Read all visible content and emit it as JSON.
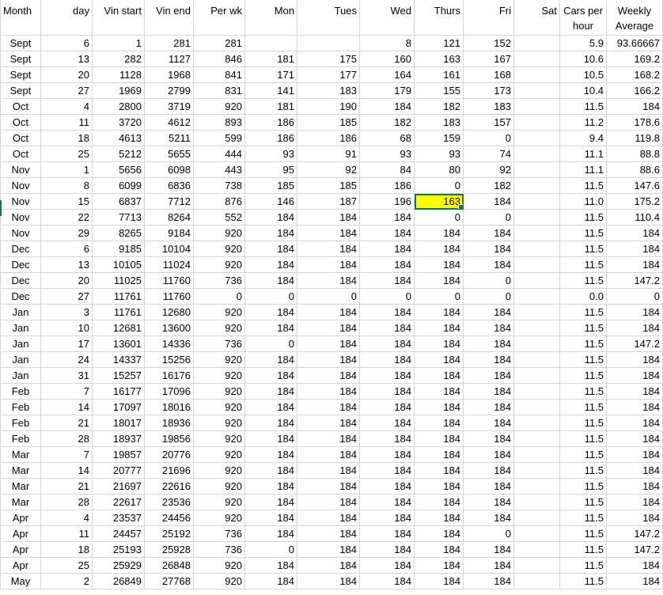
{
  "headers": [
    "Month",
    "day",
    "Vin start",
    "Vin end",
    "Per wk",
    "Mon",
    "Tues",
    "Wed",
    "Thurs",
    "Fri",
    "Sat",
    "Cars per hour",
    "Weekly Average"
  ],
  "header_align": [
    "first",
    "",
    "",
    "",
    "",
    "",
    "",
    "",
    "",
    "",
    "",
    "ctr",
    "ctr"
  ],
  "selected_cell": {
    "row": 10,
    "col": 8,
    "fill": "#ffff00",
    "border": "#217346"
  },
  "grid_color": "#d4d4d4",
  "rows": [
    [
      "Sept",
      "6",
      "1",
      "281",
      "281",
      "",
      "",
      "8",
      "121",
      "152",
      "",
      "5.9",
      "93.66667"
    ],
    [
      "Sept",
      "13",
      "282",
      "1127",
      "846",
      "181",
      "175",
      "160",
      "163",
      "167",
      "",
      "10.6",
      "169.2"
    ],
    [
      "Sept",
      "20",
      "1128",
      "1968",
      "841",
      "171",
      "177",
      "164",
      "161",
      "168",
      "",
      "10.5",
      "168.2"
    ],
    [
      "Sept",
      "27",
      "1969",
      "2799",
      "831",
      "141",
      "183",
      "179",
      "155",
      "173",
      "",
      "10.4",
      "166.2"
    ],
    [
      "Oct",
      "4",
      "2800",
      "3719",
      "920",
      "181",
      "190",
      "184",
      "182",
      "183",
      "",
      "11.5",
      "184"
    ],
    [
      "Oct",
      "11",
      "3720",
      "4612",
      "893",
      "186",
      "185",
      "182",
      "183",
      "157",
      "",
      "11.2",
      "178.6"
    ],
    [
      "Oct",
      "18",
      "4613",
      "5211",
      "599",
      "186",
      "186",
      "68",
      "159",
      "0",
      "",
      "9.4",
      "119.8"
    ],
    [
      "Oct",
      "25",
      "5212",
      "5655",
      "444",
      "93",
      "91",
      "93",
      "93",
      "74",
      "",
      "11.1",
      "88.8"
    ],
    [
      "Nov",
      "1",
      "5656",
      "6098",
      "443",
      "95",
      "92",
      "84",
      "80",
      "92",
      "",
      "11.1",
      "88.6"
    ],
    [
      "Nov",
      "8",
      "6099",
      "6836",
      "738",
      "185",
      "185",
      "186",
      "0",
      "182",
      "",
      "11.5",
      "147.6"
    ],
    [
      "Nov",
      "15",
      "6837",
      "7712",
      "876",
      "146",
      "187",
      "196",
      "163",
      "184",
      "",
      "11.0",
      "175.2"
    ],
    [
      "Nov",
      "22",
      "7713",
      "8264",
      "552",
      "184",
      "184",
      "184",
      "0",
      "0",
      "",
      "11.5",
      "110.4"
    ],
    [
      "Nov",
      "29",
      "8265",
      "9184",
      "920",
      "184",
      "184",
      "184",
      "184",
      "184",
      "",
      "11.5",
      "184"
    ],
    [
      "Dec",
      "6",
      "9185",
      "10104",
      "920",
      "184",
      "184",
      "184",
      "184",
      "184",
      "",
      "11.5",
      "184"
    ],
    [
      "Dec",
      "13",
      "10105",
      "11024",
      "920",
      "184",
      "184",
      "184",
      "184",
      "184",
      "",
      "11.5",
      "184"
    ],
    [
      "Dec",
      "20",
      "11025",
      "11760",
      "736",
      "184",
      "184",
      "184",
      "184",
      "0",
      "",
      "11.5",
      "147.2"
    ],
    [
      "Dec",
      "27",
      "11761",
      "11760",
      "0",
      "0",
      "0",
      "0",
      "0",
      "0",
      "",
      "0.0",
      "0"
    ],
    [
      "Jan",
      "3",
      "11761",
      "12680",
      "920",
      "184",
      "184",
      "184",
      "184",
      "184",
      "",
      "11.5",
      "184"
    ],
    [
      "Jan",
      "10",
      "12681",
      "13600",
      "920",
      "184",
      "184",
      "184",
      "184",
      "184",
      "",
      "11.5",
      "184"
    ],
    [
      "Jan",
      "17",
      "13601",
      "14336",
      "736",
      "0",
      "184",
      "184",
      "184",
      "184",
      "",
      "11.5",
      "147.2"
    ],
    [
      "Jan",
      "24",
      "14337",
      "15256",
      "920",
      "184",
      "184",
      "184",
      "184",
      "184",
      "",
      "11.5",
      "184"
    ],
    [
      "Jan",
      "31",
      "15257",
      "16176",
      "920",
      "184",
      "184",
      "184",
      "184",
      "184",
      "",
      "11.5",
      "184"
    ],
    [
      "Feb",
      "7",
      "16177",
      "17096",
      "920",
      "184",
      "184",
      "184",
      "184",
      "184",
      "",
      "11.5",
      "184"
    ],
    [
      "Feb",
      "14",
      "17097",
      "18016",
      "920",
      "184",
      "184",
      "184",
      "184",
      "184",
      "",
      "11.5",
      "184"
    ],
    [
      "Feb",
      "21",
      "18017",
      "18936",
      "920",
      "184",
      "184",
      "184",
      "184",
      "184",
      "",
      "11.5",
      "184"
    ],
    [
      "Feb",
      "28",
      "18937",
      "19856",
      "920",
      "184",
      "184",
      "184",
      "184",
      "184",
      "",
      "11.5",
      "184"
    ],
    [
      "Mar",
      "7",
      "19857",
      "20776",
      "920",
      "184",
      "184",
      "184",
      "184",
      "184",
      "",
      "11.5",
      "184"
    ],
    [
      "Mar",
      "14",
      "20777",
      "21696",
      "920",
      "184",
      "184",
      "184",
      "184",
      "184",
      "",
      "11.5",
      "184"
    ],
    [
      "Mar",
      "21",
      "21697",
      "22616",
      "920",
      "184",
      "184",
      "184",
      "184",
      "184",
      "",
      "11.5",
      "184"
    ],
    [
      "Mar",
      "28",
      "22617",
      "23536",
      "920",
      "184",
      "184",
      "184",
      "184",
      "184",
      "",
      "11.5",
      "184"
    ],
    [
      "Apr",
      "4",
      "23537",
      "24456",
      "920",
      "184",
      "184",
      "184",
      "184",
      "184",
      "",
      "11.5",
      "184"
    ],
    [
      "Apr",
      "11",
      "24457",
      "25192",
      "736",
      "184",
      "184",
      "184",
      "184",
      "0",
      "",
      "11.5",
      "147.2"
    ],
    [
      "Apr",
      "18",
      "25193",
      "25928",
      "736",
      "0",
      "184",
      "184",
      "184",
      "184",
      "",
      "11.5",
      "147.2"
    ],
    [
      "Apr",
      "25",
      "25929",
      "26848",
      "920",
      "184",
      "184",
      "184",
      "184",
      "184",
      "",
      "11.5",
      "184"
    ],
    [
      "May",
      "2",
      "26849",
      "27768",
      "920",
      "184",
      "184",
      "184",
      "184",
      "184",
      "",
      "11.5",
      "184"
    ]
  ]
}
